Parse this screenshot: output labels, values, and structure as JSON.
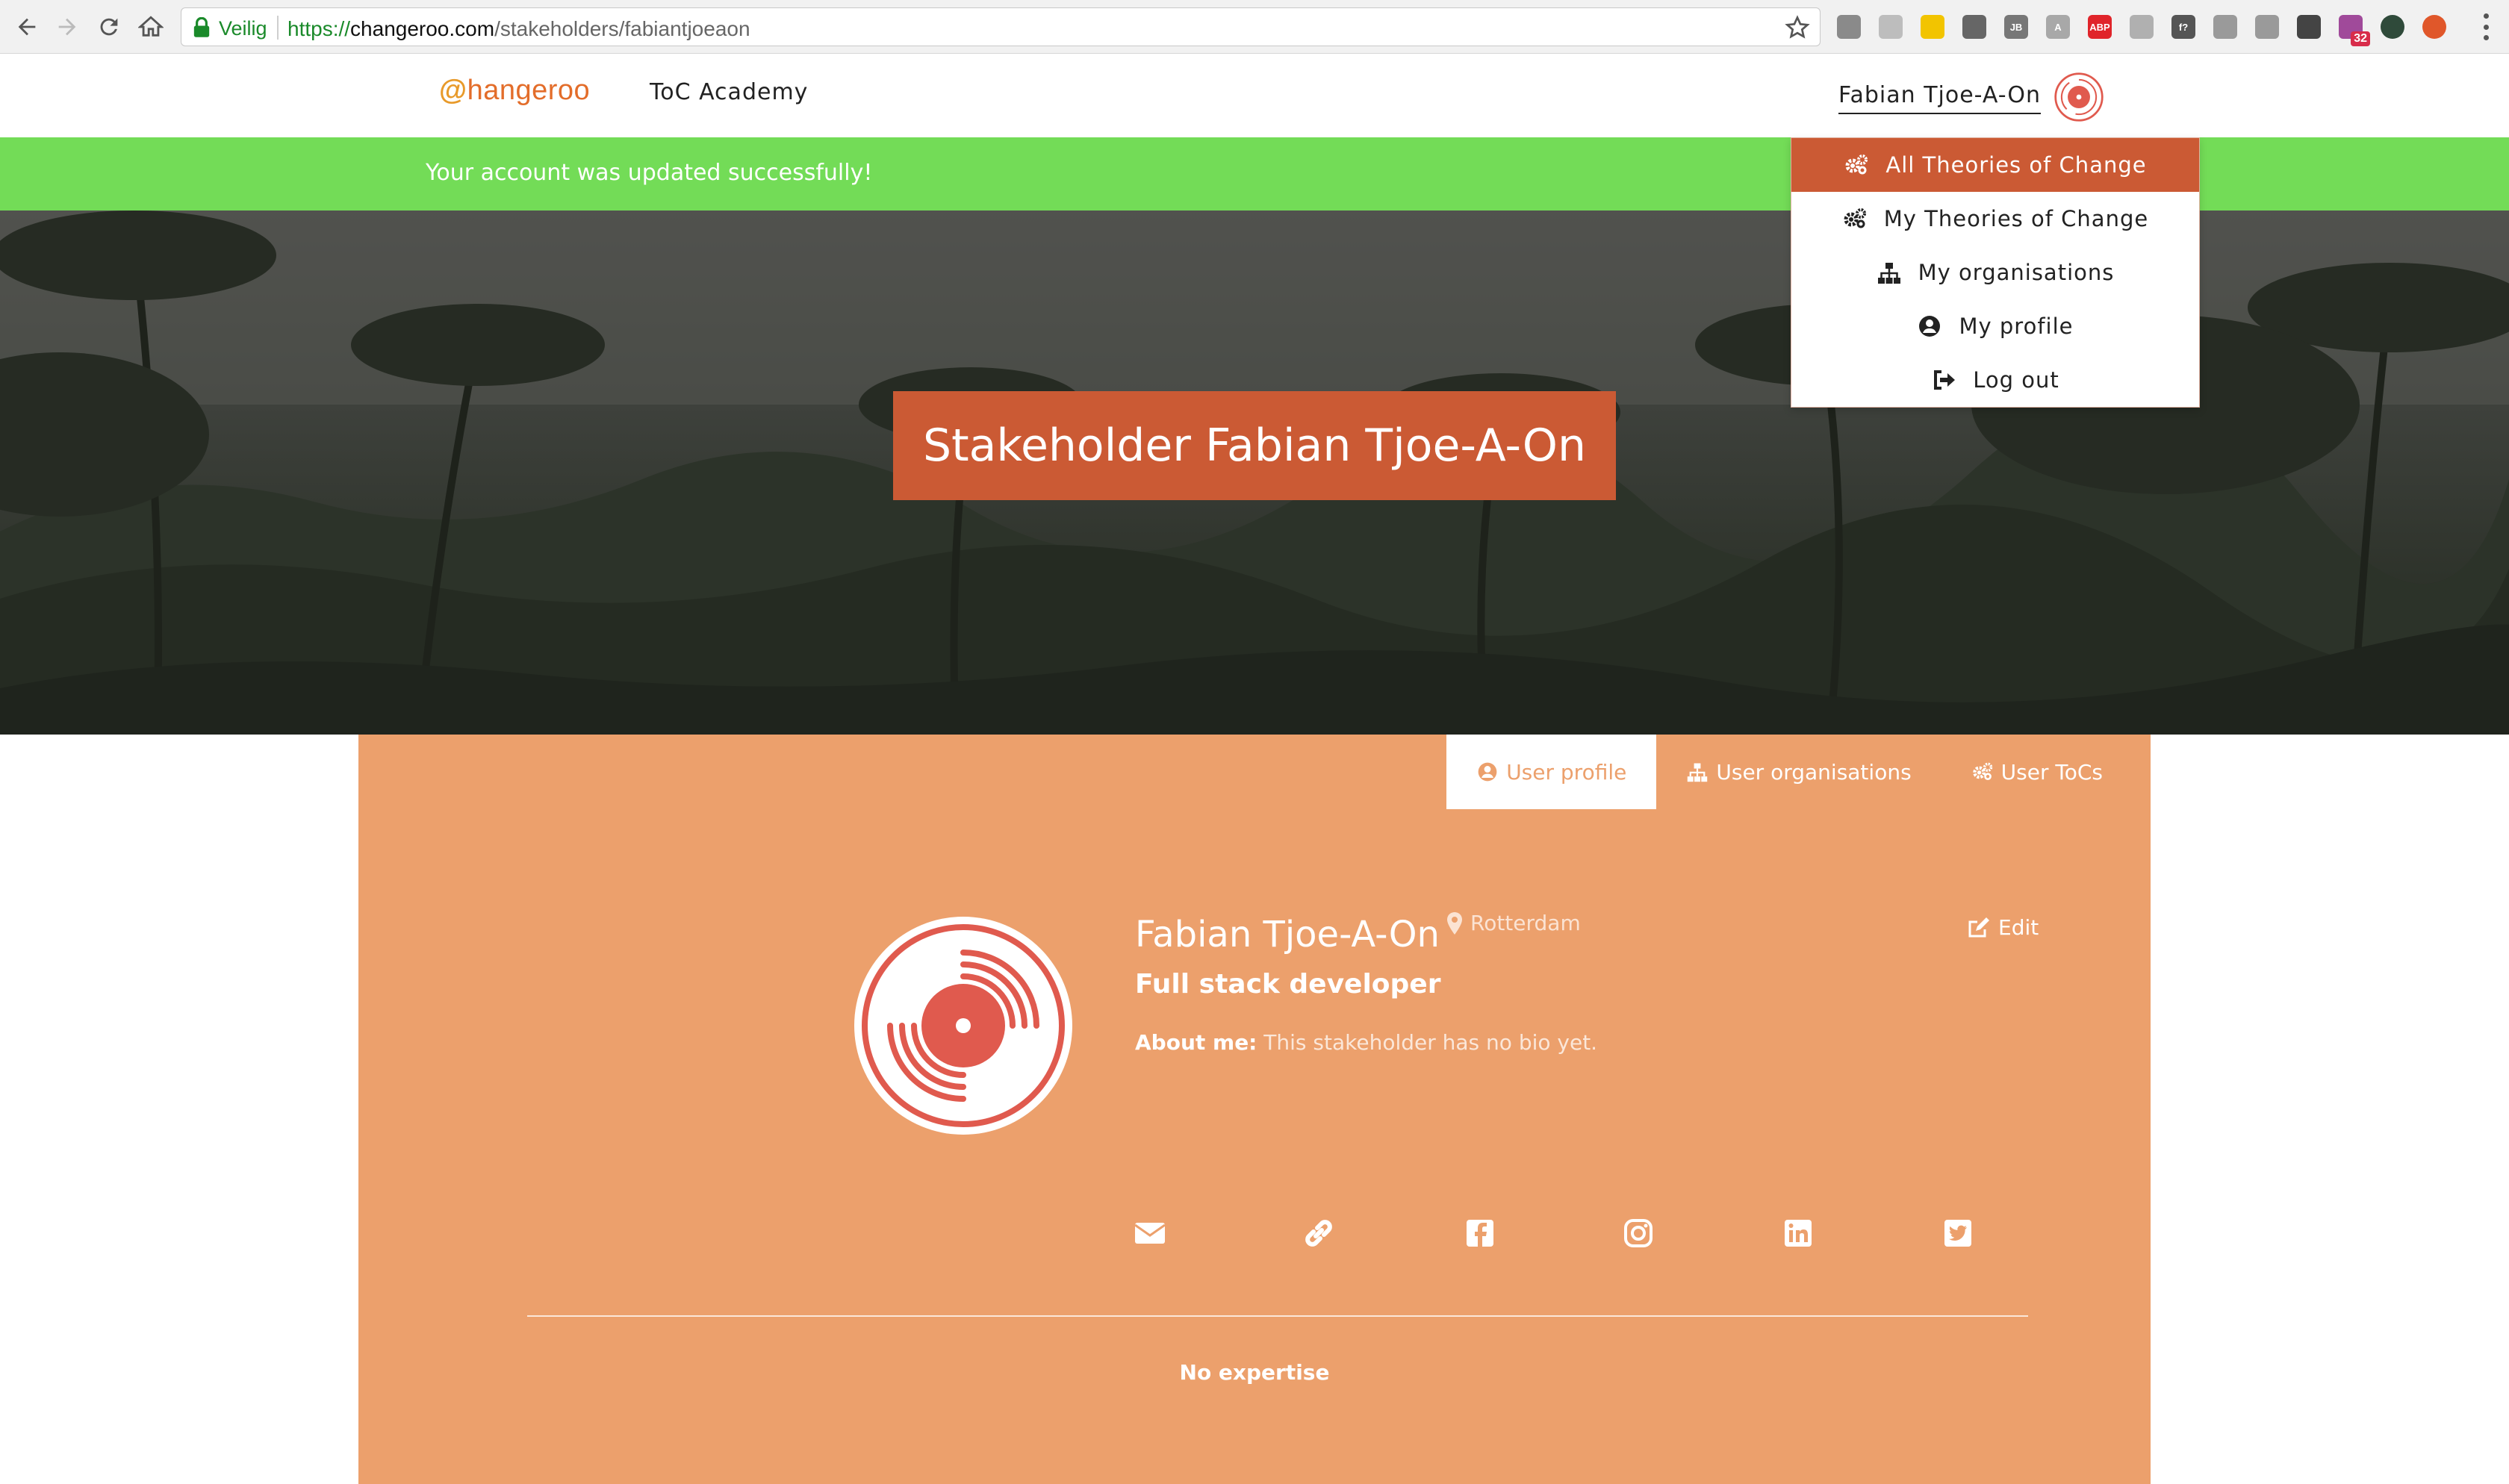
{
  "browser": {
    "secure_label": "Veilig",
    "url_scheme": "https://",
    "url_host": "changeroo.com",
    "url_path": "/stakeholders/fabiantjoeaon",
    "extensions": [
      {
        "name": "puzzle-extension",
        "color": "#8a8a8a",
        "text": ""
      },
      {
        "name": "doc-extension",
        "color": "#bdbdbd",
        "text": ""
      },
      {
        "name": "flag-extension",
        "color": "#f2c400",
        "text": ""
      },
      {
        "name": "target-extension",
        "color": "#666666",
        "text": ""
      },
      {
        "name": "jb-extension",
        "color": "#777777",
        "text": "JB"
      },
      {
        "name": "a-extension",
        "color": "#a8a8a8",
        "text": "A"
      },
      {
        "name": "adblock-extension",
        "color": "#e0242a",
        "text": "ABP"
      },
      {
        "name": "shield-extension",
        "color": "#b0b0b0",
        "text": ""
      },
      {
        "name": "font-extension",
        "color": "#555555",
        "text": "f?"
      },
      {
        "name": "mail-extension",
        "color": "#9a9a9a",
        "text": ""
      },
      {
        "name": "camera-extension",
        "color": "#9a9a9a",
        "text": ""
      },
      {
        "name": "react-extension",
        "color": "#444444",
        "text": ""
      },
      {
        "name": "calendar-extension",
        "color": "#a04a9a",
        "text": "",
        "badge": "32"
      },
      {
        "name": "green-dot-extension",
        "color": "#2f4a3a",
        "text": ""
      },
      {
        "name": "orange-dot-extension",
        "color": "#e0572a",
        "text": ""
      }
    ]
  },
  "header": {
    "logo_c": "@",
    "logo_rest": "hangeroo",
    "nav_academy": "ToC Academy",
    "user_name": "Fabian Tjoe-A-On"
  },
  "flash": {
    "message": "Your account was updated successfully!"
  },
  "hero": {
    "title": "Stakeholder Fabian Tjoe-A-On"
  },
  "dropdown": {
    "items": [
      {
        "label": "All Theories of Change",
        "icon": "cogs-icon",
        "active": true
      },
      {
        "label": "My Theories of Change",
        "icon": "cogs-icon",
        "active": false
      },
      {
        "label": "My organisations",
        "icon": "sitemap-icon",
        "active": false
      },
      {
        "label": "My profile",
        "icon": "user-circle-icon",
        "active": false
      },
      {
        "label": "Log out",
        "icon": "sign-out-icon",
        "active": false
      }
    ]
  },
  "profile": {
    "tabs": [
      {
        "label": "User profile",
        "icon": "user-circle-icon",
        "active": true
      },
      {
        "label": "User organisations",
        "icon": "sitemap-icon",
        "active": false
      },
      {
        "label": "User ToCs",
        "icon": "cogs-icon",
        "active": false
      }
    ],
    "name": "Fabian Tjoe-A-On",
    "location": "Rotterdam",
    "job_title": "Full stack developer",
    "about_label": "About me:",
    "about_text": " This stakeholder has no bio yet.",
    "edit_label": "Edit",
    "socials": [
      "envelope-icon",
      "link-icon",
      "facebook-icon",
      "instagram-icon",
      "linkedin-icon",
      "twitter-icon"
    ],
    "expertise": "No expertise"
  },
  "colors": {
    "accent": "#cb5a34",
    "card": "#eca06c",
    "success": "#73dc57",
    "avatar_red": "#e05a4e"
  }
}
